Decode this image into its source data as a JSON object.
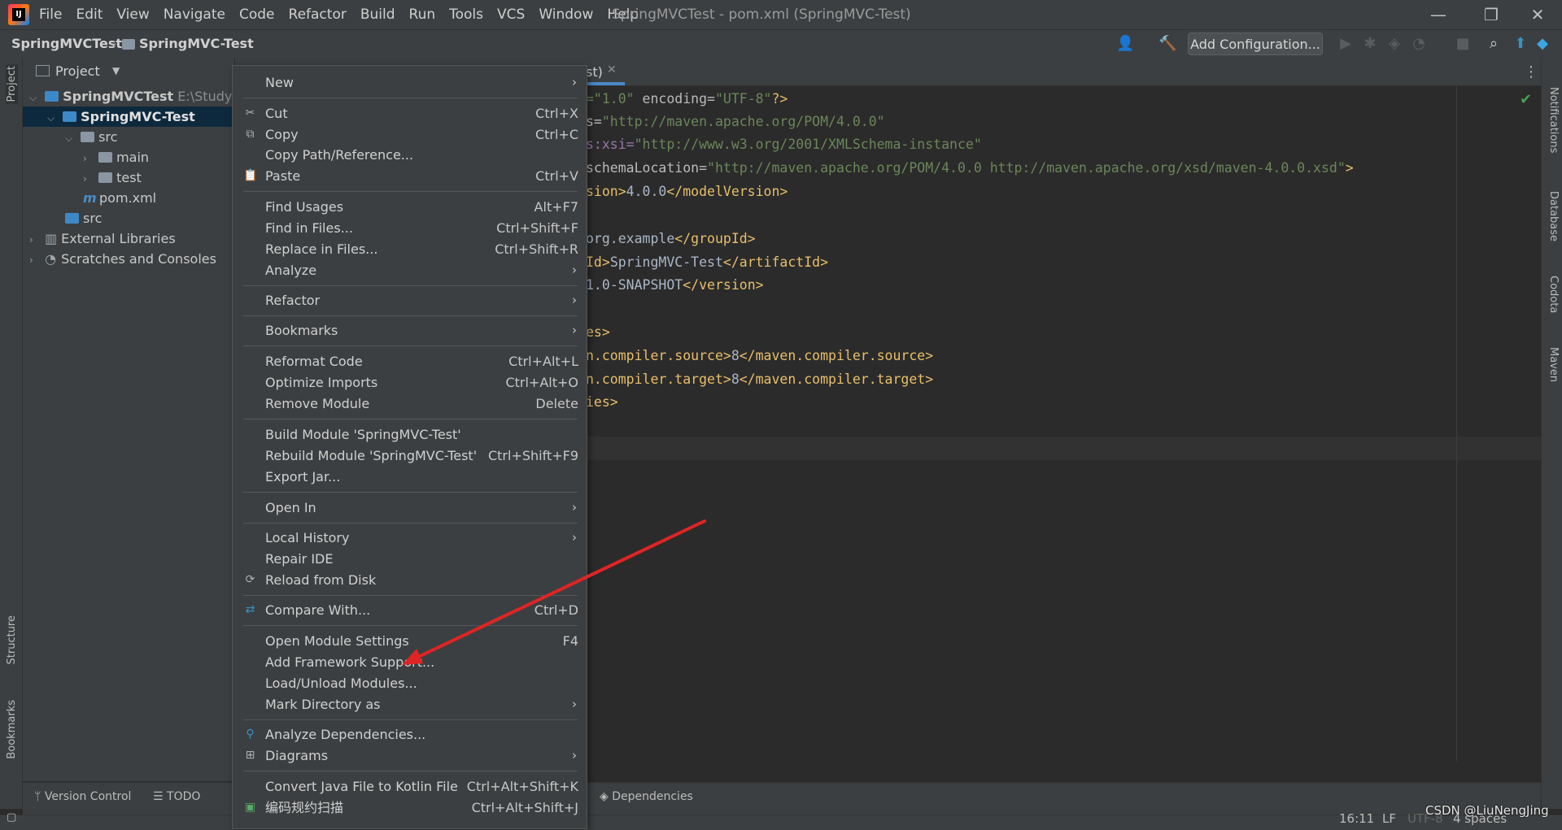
{
  "titlebar": {
    "menus": [
      "File",
      "Edit",
      "View",
      "Navigate",
      "Code",
      "Refactor",
      "Build",
      "Run",
      "Tools",
      "VCS",
      "Window",
      "Help"
    ],
    "window_title": "SpringMVCTest - pom.xml (SpringMVC-Test)",
    "minimize": "—",
    "restore": "❐",
    "close": "✕"
  },
  "navbar": {
    "crumb_project": "SpringMVCTest",
    "crumb_module": "SpringMVC-Test",
    "add_configuration": "Add Configuration..."
  },
  "left_stripe": {
    "project": "Project",
    "structure": "Structure",
    "bookmarks": "Bookmarks"
  },
  "right_stripe": {
    "notifications": "Notifications",
    "database": "Database",
    "codota": "Codota",
    "maven": "Maven"
  },
  "project_panel": {
    "title": "Project",
    "tree": {
      "root_name": "SpringMVCTest",
      "root_path": "E:\\Study\\Sp",
      "module": "SpringMVC-Test",
      "src": "src",
      "main": "main",
      "test": "test",
      "pom": "pom.xml",
      "src2": "src",
      "external_libraries": "External Libraries",
      "scratches": "Scratches and Consoles"
    }
  },
  "editor": {
    "tab_label_fragment": "st)",
    "code": [
      {
        "a": "=\"1.0\"",
        "b": " encoding=",
        "c": "\"UTF-8\"",
        "d": "?>"
      },
      {
        "a": "s=",
        "b": "\"http://maven.apache.org/POM/4.0.0\""
      },
      {
        "a": "s:xsi=",
        "b": "\"http://www.w3.org/2001/XMLSchema-instance\""
      },
      {
        "a": "schemaLocation=",
        "b": "\"http://maven.apache.org/POM/4.0.0 http://maven.apache.org/xsd/maven-4.0.0.xsd\"",
        "c": ">"
      },
      {
        "a": "sion>",
        "b": "4.0.0",
        "c": "</modelVersion>"
      },
      {
        "a": "org.example",
        "b": "</groupId>"
      },
      {
        "a": "Id>",
        "b": "SpringMVC-Test",
        "c": "</artifactId>"
      },
      {
        "a": "1.0-SNAPSHOT",
        "b": "</version>"
      },
      {
        "a": "es>"
      },
      {
        "a": "n.compiler.source>",
        "b": "8",
        "c": "</maven.compiler.source>"
      },
      {
        "a": "n.compiler.target>",
        "b": "8",
        "c": "</maven.compiler.target>"
      },
      {
        "a": "ies>"
      }
    ]
  },
  "context_menu": {
    "items": [
      {
        "label": "New",
        "shortcut": "",
        "submenu": true
      },
      {
        "label": "Cut",
        "shortcut": "Ctrl+X",
        "icon": "cut-icon"
      },
      {
        "label": "Copy",
        "shortcut": "Ctrl+C",
        "icon": "copy-icon"
      },
      {
        "label": "Copy Path/Reference...",
        "shortcut": ""
      },
      {
        "label": "Paste",
        "shortcut": "Ctrl+V",
        "icon": "paste-icon"
      },
      {
        "label": "Find Usages",
        "shortcut": "Alt+F7"
      },
      {
        "label": "Find in Files...",
        "shortcut": "Ctrl+Shift+F"
      },
      {
        "label": "Replace in Files...",
        "shortcut": "Ctrl+Shift+R"
      },
      {
        "label": "Analyze",
        "shortcut": "",
        "submenu": true
      },
      {
        "label": "Refactor",
        "shortcut": "",
        "submenu": true
      },
      {
        "label": "Bookmarks",
        "shortcut": "",
        "submenu": true
      },
      {
        "label": "Reformat Code",
        "shortcut": "Ctrl+Alt+L"
      },
      {
        "label": "Optimize Imports",
        "shortcut": "Ctrl+Alt+O"
      },
      {
        "label": "Remove Module",
        "shortcut": "Delete"
      },
      {
        "label": "Build Module 'SpringMVC-Test'",
        "shortcut": ""
      },
      {
        "label": "Rebuild Module 'SpringMVC-Test'",
        "shortcut": "Ctrl+Shift+F9"
      },
      {
        "label": "Export Jar...",
        "shortcut": ""
      },
      {
        "label": "Open In",
        "shortcut": "",
        "submenu": true
      },
      {
        "label": "Local History",
        "shortcut": "",
        "submenu": true
      },
      {
        "label": "Repair IDE",
        "shortcut": ""
      },
      {
        "label": "Reload from Disk",
        "shortcut": "",
        "icon": "reload-icon"
      },
      {
        "label": "Compare With...",
        "shortcut": "Ctrl+D",
        "icon": "compare-icon"
      },
      {
        "label": "Open Module Settings",
        "shortcut": "F4"
      },
      {
        "label": "Add Framework Support...",
        "shortcut": ""
      },
      {
        "label": "Load/Unload Modules...",
        "shortcut": ""
      },
      {
        "label": "Mark Directory as",
        "shortcut": "",
        "submenu": true
      },
      {
        "label": "Analyze Dependencies...",
        "shortcut": "",
        "icon": "analyze-dependencies-icon"
      },
      {
        "label": "Diagrams",
        "shortcut": "",
        "submenu": true,
        "icon": "diagrams-icon"
      },
      {
        "label": "Convert Java File to Kotlin File",
        "shortcut": "Ctrl+Alt+Shift+K"
      },
      {
        "label": "编码规约扫描",
        "shortcut": "Ctrl+Alt+Shift+J",
        "icon": "scan-icon"
      }
    ]
  },
  "bottom_tools": {
    "version_control": "Version Control",
    "todo": "TODO",
    "dependencies": "Dependencies"
  },
  "statusbar": {
    "position": "16:11",
    "line_sep": "LF",
    "encoding": "UTF-8",
    "indent": "4 spaces",
    "watermark": "CSDN @LiuNengJing"
  },
  "colors": {
    "accent": "#4a88c7",
    "annotation_arrow": "#e02424",
    "selection": "#0d293e"
  }
}
